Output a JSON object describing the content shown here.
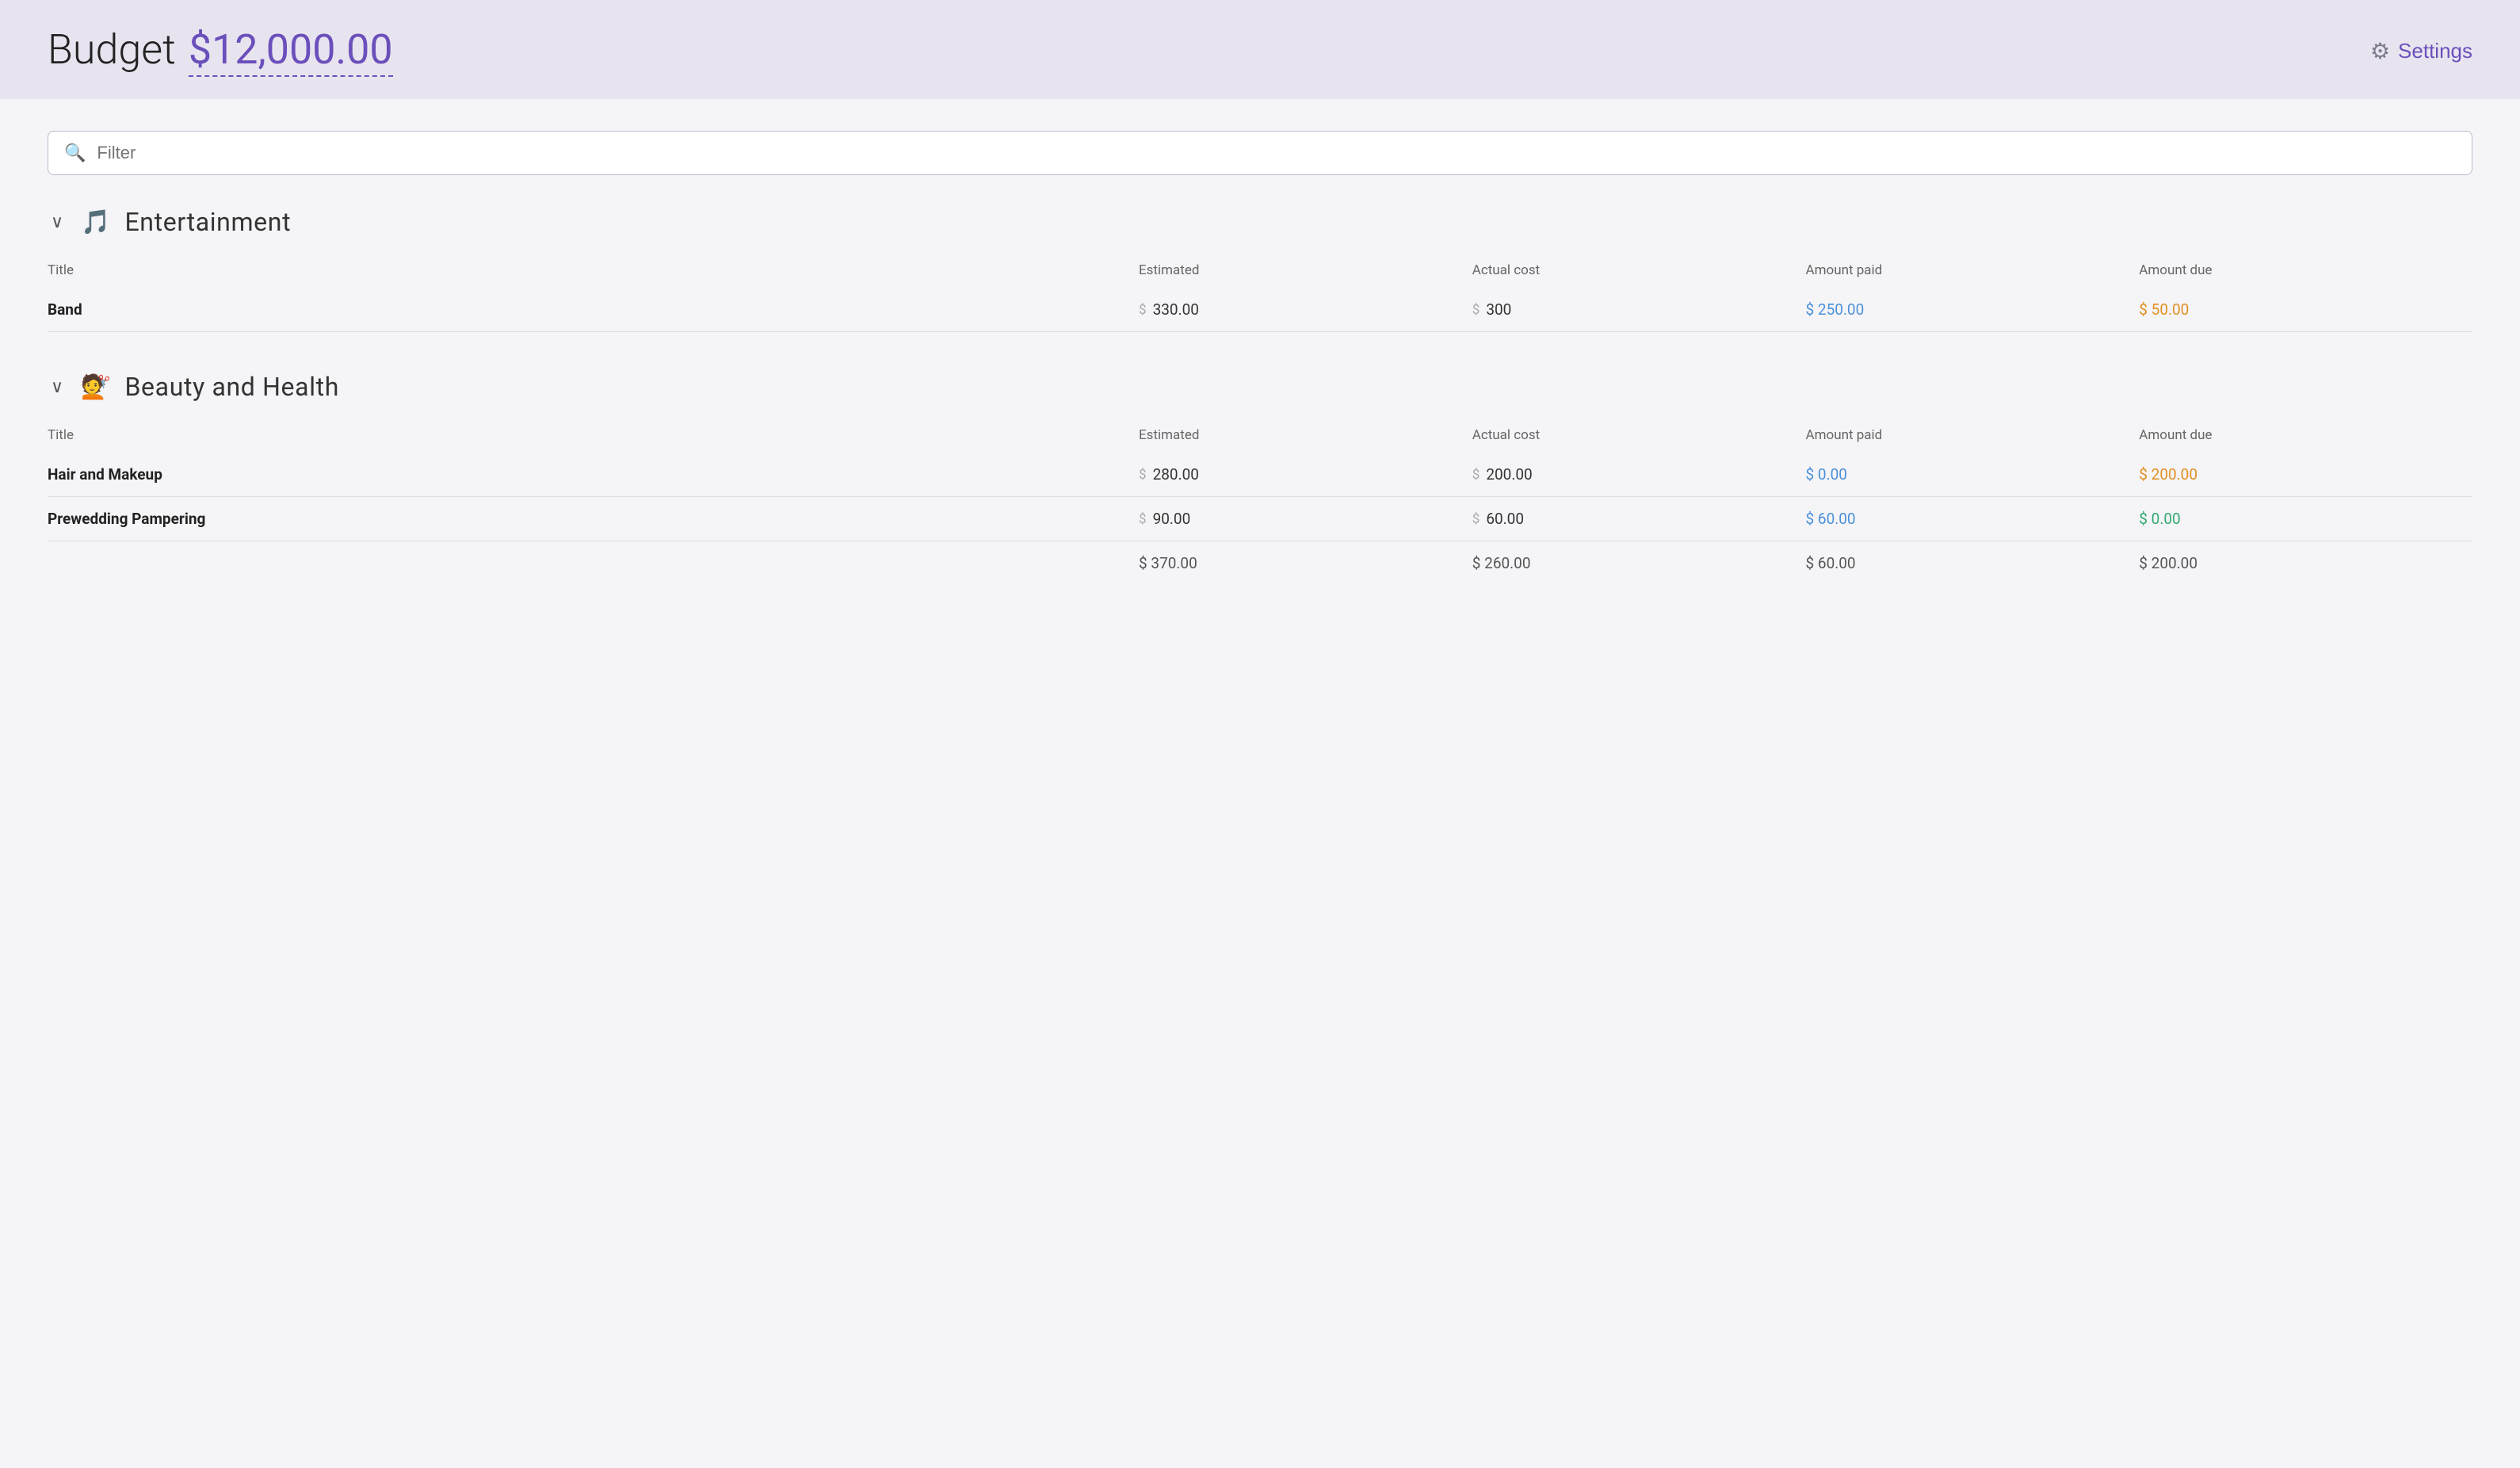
{
  "header": {
    "title_text": "Budget",
    "budget_amount": "$12,000.00",
    "settings_label": "Settings"
  },
  "filter": {
    "placeholder": "Filter"
  },
  "sections": [
    {
      "id": "entertainment",
      "icon": "🎵",
      "title": "Entertainment",
      "columns": [
        "Title",
        "Estimated",
        "Actual cost",
        "Amount paid",
        "Amount due"
      ],
      "rows": [
        {
          "title": "Band",
          "estimated": "330.00",
          "actual_cost": "300",
          "amount_paid": "$ 250.00",
          "amount_due": "$ 50.00",
          "paid_color": "blue",
          "due_color": "orange"
        }
      ],
      "totals": null
    },
    {
      "id": "beauty-and-health",
      "icon": "💇",
      "title": "Beauty and Health",
      "columns": [
        "Title",
        "Estimated",
        "Actual cost",
        "Amount paid",
        "Amount due"
      ],
      "rows": [
        {
          "title": "Hair and Makeup",
          "estimated": "280.00",
          "actual_cost": "200.00",
          "amount_paid": "$ 0.00",
          "amount_due": "$ 200.00",
          "paid_color": "blue",
          "due_color": "orange"
        },
        {
          "title": "Prewedding Pampering",
          "estimated": "90.00",
          "actual_cost": "60.00",
          "amount_paid": "$ 60.00",
          "amount_due": "$ 0.00",
          "paid_color": "blue",
          "due_color": "green"
        }
      ],
      "totals": {
        "estimated": "$ 370.00",
        "actual_cost": "$ 260.00",
        "amount_paid": "$ 60.00",
        "amount_due": "$ 200.00"
      }
    }
  ]
}
